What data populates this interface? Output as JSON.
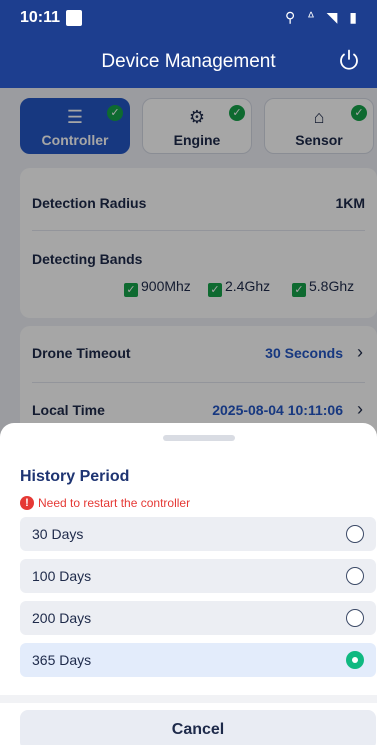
{
  "status_bar": {
    "time": "10:11",
    "icons": "⚲ ᐞ ◥ ▮"
  },
  "header": {
    "title": "Device Management"
  },
  "tabs": [
    {
      "label": "Controller",
      "icon": "sliders-icon",
      "glyph": "☰",
      "active": true
    },
    {
      "label": "Engine",
      "icon": "engine-icon",
      "glyph": "⚙",
      "active": false
    },
    {
      "label": "Sensor",
      "icon": "router-icon",
      "glyph": "⌂",
      "active": false
    }
  ],
  "settings": {
    "detection_radius": {
      "label": "Detection Radius",
      "value": "1KM"
    },
    "detecting_bands": {
      "label": "Detecting Bands",
      "bands": [
        "900Mhz",
        "2.4Ghz",
        "5.8Ghz"
      ]
    },
    "drone_timeout": {
      "label": "Drone Timeout",
      "value": "30 Seconds"
    },
    "local_time": {
      "label": "Local Time",
      "value": "2025-08-04 10:11:06"
    }
  },
  "sheet": {
    "title": "History Period",
    "warning": "Need to restart the controller",
    "options": [
      {
        "label": "30 Days",
        "selected": false
      },
      {
        "label": "100 Days",
        "selected": false
      },
      {
        "label": "200 Days",
        "selected": false
      },
      {
        "label": "365 Days",
        "selected": true
      }
    ],
    "cancel_label": "Cancel"
  },
  "colors": {
    "header": "#1d3e8f",
    "accent": "#2457c5",
    "success": "#16a34a",
    "warning": "#e53935",
    "selected_radio": "#10b981"
  }
}
